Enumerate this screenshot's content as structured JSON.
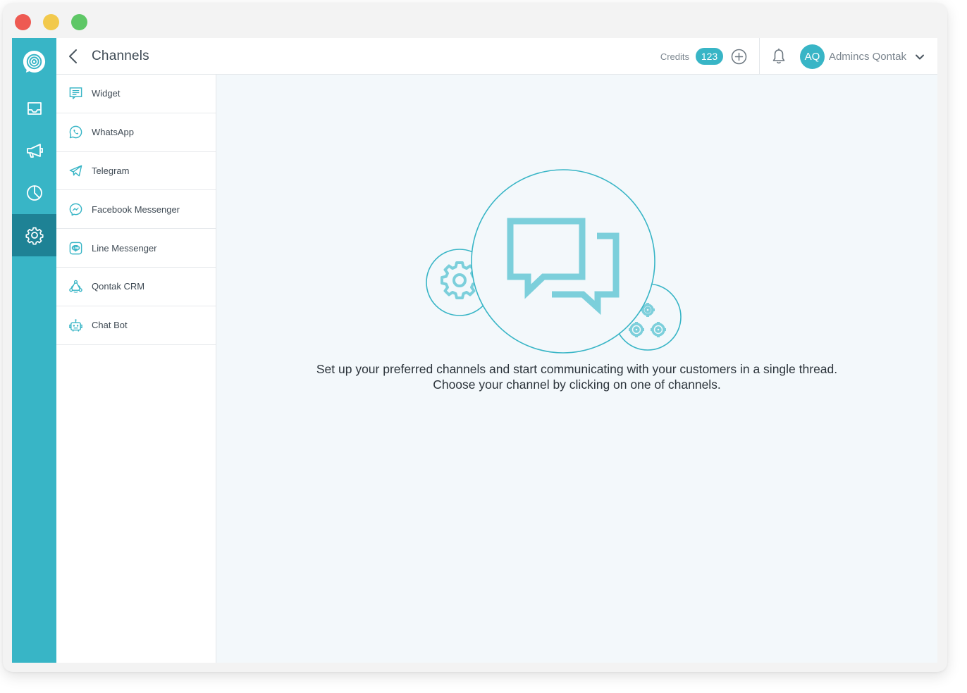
{
  "header": {
    "title": "Channels",
    "credits_label": "Credits",
    "credits_value": "123",
    "user": {
      "initials": "AQ",
      "name": "Admincs Qontak"
    }
  },
  "rail": {
    "items": [
      {
        "icon": "inbox-icon",
        "active": false
      },
      {
        "icon": "megaphone-icon",
        "active": false
      },
      {
        "icon": "pie-chart-icon",
        "active": false
      },
      {
        "icon": "gear-icon",
        "active": true
      }
    ]
  },
  "channels": [
    {
      "label": "Widget",
      "icon": "widget-icon"
    },
    {
      "label": "WhatsApp",
      "icon": "whatsapp-icon"
    },
    {
      "label": "Telegram",
      "icon": "telegram-icon"
    },
    {
      "label": "Facebook Messenger",
      "icon": "messenger-icon"
    },
    {
      "label": "Line Messenger",
      "icon": "line-icon"
    },
    {
      "label": "Qontak CRM",
      "icon": "crm-icon"
    },
    {
      "label": "Chat Bot",
      "icon": "robot-icon"
    }
  ],
  "empty_state": {
    "line1": "Set up your preferred channels and start communicating with your customers in a single thread.",
    "line2": "Choose your channel by clicking on one of channels."
  },
  "colors": {
    "accent": "#38b5c6",
    "rail_active": "#1e8295",
    "main_bg": "#f3f8fb",
    "illustration": "#7ccfdb"
  }
}
